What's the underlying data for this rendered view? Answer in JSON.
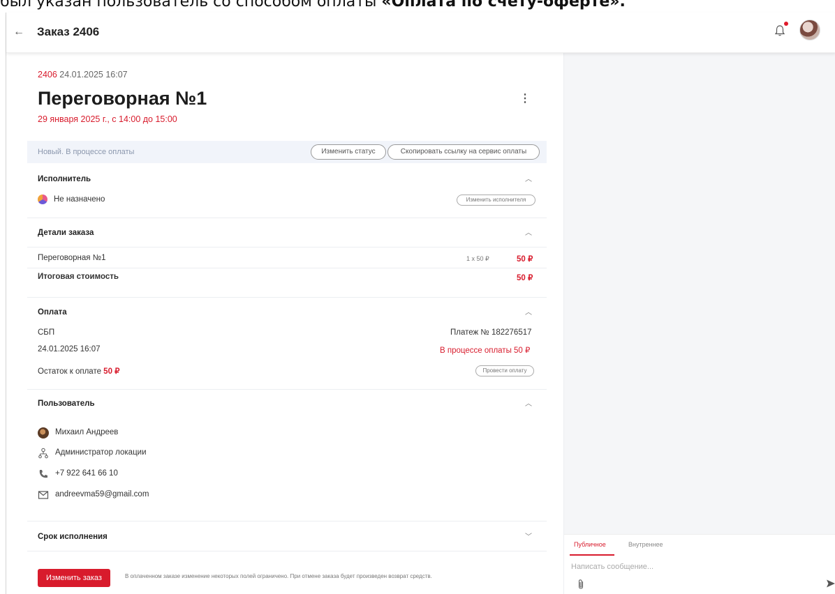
{
  "top_strip": {
    "normal": "был указан пользователь со способом оплаты ",
    "bold": "«Оплата по счету-оферте»."
  },
  "header": {
    "title": "Заказ 2406"
  },
  "order": {
    "number": "2406",
    "created": " 24.01.2025 16:07",
    "title": "Переговорная №1",
    "time_range": "29 января 2025 г., с 14:00 до 15:00"
  },
  "status": {
    "text": "Новый. В процессе оплаты",
    "change_label": "Изменить статус",
    "copy_link_label": "Скопировать ссылку на сервис оплаты"
  },
  "executor": {
    "title": "Исполнитель",
    "value": "Не назначено",
    "change_label": "Изменить исполнителя"
  },
  "details": {
    "title": "Детали заказа",
    "item_name": "Переговорная №1",
    "item_qty": "1 x 50 ₽",
    "item_price": "50 ₽",
    "total_label": "Итоговая стоимость",
    "total_value": "50 ₽"
  },
  "payment": {
    "title": "Оплата",
    "method": "СБП",
    "payment_no": "Платеж № 182276517",
    "date": "24.01.2025 16:07",
    "state": "В процессе оплаты 50 ₽",
    "remaining_label": "Остаток к оплате ",
    "remaining_value": "50 ₽",
    "pay_label": "Провести оплату"
  },
  "user": {
    "title": "Пользователь",
    "name": "Михаил Андреев",
    "role": "Администратор локации",
    "phone": "+7 922 641 66 10",
    "email": "andreevma59@gmail.com"
  },
  "deadline": {
    "title": "Срок исполнения"
  },
  "footer": {
    "edit_label": "Изменить заказ",
    "note": "В оплаченном заказе изменение некоторых полей ограничено. При отмене заказа будет произведен возврат средств."
  },
  "chat": {
    "tab_public": "Публичное",
    "tab_internal": "Внутреннее",
    "placeholder": "Написать сообщение..."
  },
  "colors": {
    "accent": "#d81b2c",
    "status_bg": "#f1f4fa",
    "side_bg": "#f5f6f8"
  }
}
